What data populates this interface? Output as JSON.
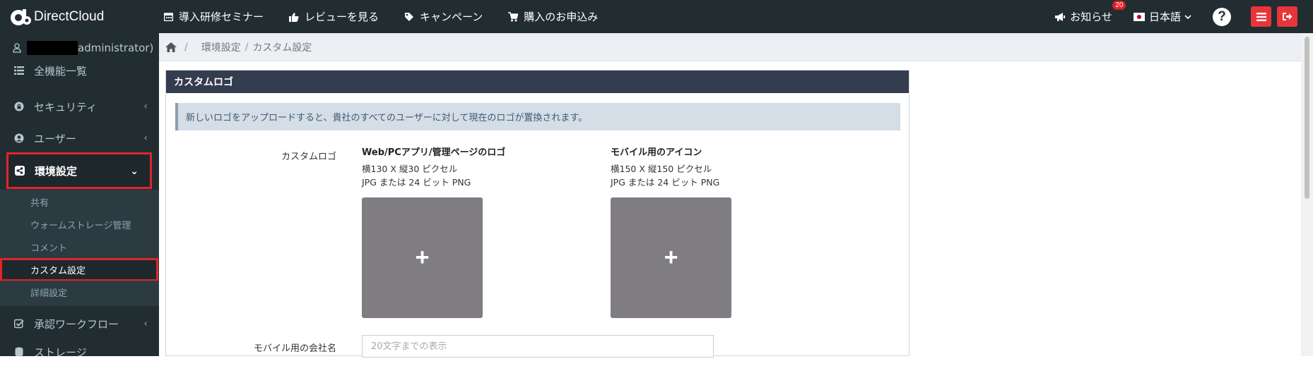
{
  "header": {
    "logo_text": "DirectCloud",
    "nav": [
      {
        "label": "導入研修セミナー",
        "icon": "calendar-icon"
      },
      {
        "label": "レビューを見る",
        "icon": "thumbs-up-icon"
      },
      {
        "label": "キャンペーン",
        "icon": "tag-icon"
      },
      {
        "label": "購入のお申込み",
        "icon": "cart-icon"
      }
    ],
    "notice_label": "お知らせ",
    "notice_count": "20",
    "language": "日本語",
    "help_label": "?"
  },
  "sidebar": {
    "user_suffix": "administrator)",
    "items": [
      {
        "label": "全機能一覧",
        "icon": "list-icon"
      },
      {
        "label": "セキュリティ",
        "icon": "lock-icon"
      },
      {
        "label": "ユーザー",
        "icon": "user-circle-icon"
      },
      {
        "label": "環境設定",
        "icon": "share-icon"
      },
      {
        "label": "承認ワークフロー",
        "icon": "check-square-icon"
      },
      {
        "label": "ストレージ",
        "icon": "database-icon"
      }
    ],
    "sub_items": [
      "共有",
      "ウォームストレージ管理",
      "コメント",
      "カスタム設定",
      "詳細設定"
    ],
    "chevron": "‹",
    "chevron_open": "⌄"
  },
  "breadcrumb": {
    "home_sep": "/",
    "items": [
      "環境設定",
      "カスタム設定"
    ],
    "sep": "/"
  },
  "panel": {
    "title": "カスタムロゴ",
    "info": "新しいロゴをアップロードすると、貴社のすべてのユーザーに対して現在のロゴが置換されます。",
    "logo_label": "カスタムロゴ",
    "web_logo": {
      "title": "Web/PCアプリ/管理ページのロゴ",
      "size": "横130 X 縦30 ピクセル",
      "format": "JPG または 24 ビット PNG"
    },
    "mobile_icon": {
      "title": "モバイル用のアイコン",
      "size": "横150 X 縦150 ピクセル",
      "format": "JPG または 24 ビット PNG"
    },
    "upload_symbol": "+",
    "company_label": "モバイル用の会社名",
    "company_placeholder": "20文字までの表示"
  }
}
